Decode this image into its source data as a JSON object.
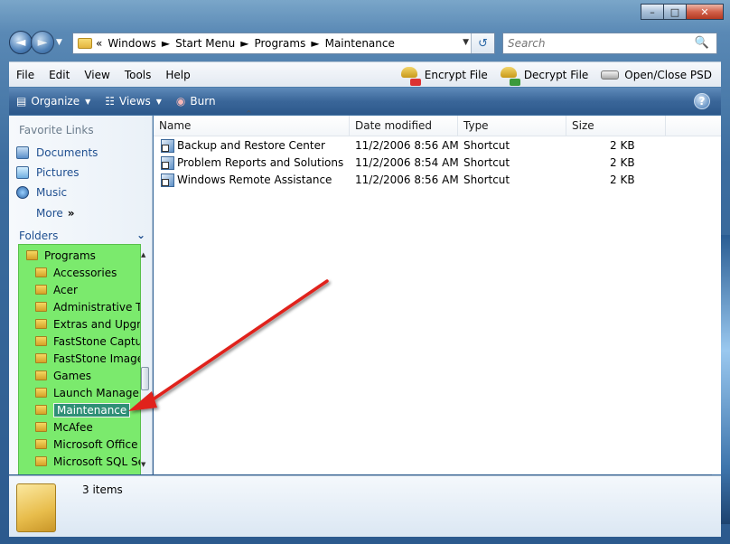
{
  "window": {
    "caption_buttons": {
      "minimize": "–",
      "maximize": "□",
      "close": "✕"
    }
  },
  "address_bar": {
    "overflow": "«",
    "crumbs": [
      "Windows",
      "Start Menu",
      "Programs",
      "Maintenance"
    ],
    "separator": "►",
    "dropdown": "▼",
    "refresh": "↺"
  },
  "search": {
    "placeholder": "Search",
    "icon": "🔍"
  },
  "menu": {
    "items": [
      "File",
      "Edit",
      "View",
      "Tools",
      "Help"
    ],
    "tools": [
      "Encrypt File",
      "Decrypt File",
      "Open/Close PSD"
    ]
  },
  "command_bar": {
    "organize": "Organize",
    "views": "Views",
    "burn": "Burn",
    "help": "?"
  },
  "left_pane": {
    "favorite_links_title": "Favorite Links",
    "links": [
      "Documents",
      "Pictures",
      "Music"
    ],
    "more": "More",
    "more_chevron": "»",
    "folders_title": "Folders",
    "folders_chevron": "⌄",
    "tree": [
      {
        "label": "Programs",
        "level": 0
      },
      {
        "label": "Accessories",
        "level": 1
      },
      {
        "label": "Acer",
        "level": 1
      },
      {
        "label": "Administrative Tools",
        "level": 1
      },
      {
        "label": "Extras and Upgrades",
        "level": 1
      },
      {
        "label": "FastStone Capture",
        "level": 1
      },
      {
        "label": "FastStone Image Viewer",
        "level": 1
      },
      {
        "label": "Games",
        "level": 1
      },
      {
        "label": "Launch Manager",
        "level": 1
      },
      {
        "label": "Maintenance",
        "level": 1,
        "selected": true
      },
      {
        "label": "McAfee",
        "level": 1
      },
      {
        "label": "Microsoft Office",
        "level": 1
      },
      {
        "label": "Microsoft SQL Server",
        "level": 1
      }
    ]
  },
  "file_list": {
    "columns": [
      "Name",
      "Date modified",
      "Type",
      "Size"
    ],
    "sort_indicator": "^",
    "rows": [
      {
        "name": "Backup and Restore Center",
        "date": "11/2/2006 8:56 AM",
        "type": "Shortcut",
        "size": "2 KB"
      },
      {
        "name": "Problem Reports and Solutions",
        "date": "11/2/2006 8:54 AM",
        "type": "Shortcut",
        "size": "2 KB"
      },
      {
        "name": "Windows Remote Assistance",
        "date": "11/2/2006 8:56 AM",
        "type": "Shortcut",
        "size": "2 KB"
      }
    ]
  },
  "status_bar": {
    "count": "3 items"
  },
  "colors": {
    "highlight_green": "#7bea6d",
    "arrow_red": "#e0201a",
    "link_blue": "#1f4f90"
  }
}
